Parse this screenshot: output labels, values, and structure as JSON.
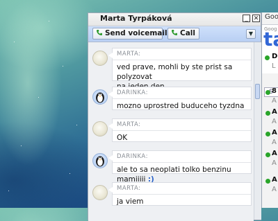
{
  "chat_window": {
    "title": "Marta Tyrpáková",
    "minimize_label": "_",
    "close_label": "✕",
    "toolbar": {
      "voicemail_label": "Send voicemail",
      "call_label": "Call",
      "more_label": "▼"
    },
    "messages": [
      {
        "sender": "MARTA:",
        "avatar": "marta",
        "lines": [
          "ved prave, mohli by ste prist sa polyzovat",
          "na jeden den"
        ]
      },
      {
        "sender": "DARINKA:",
        "avatar": "penguin",
        "lines": [
          "mozno uprostred buduceho tyzdna"
        ]
      },
      {
        "sender": "MARTA:",
        "avatar": "marta",
        "lines": [
          "OK"
        ]
      },
      {
        "sender": "DARINKA:",
        "avatar": "penguin",
        "lines": [
          "ale to sa neoplati tolko benzinu mamiiiii"
        ],
        "emoticon": ":)"
      },
      {
        "sender": "MARTA:",
        "avatar": "marta",
        "lines": [
          "ja viem"
        ]
      }
    ]
  },
  "gtalk_panel": {
    "title": "Goo",
    "logo_small": "Goog",
    "logo_text": "ta",
    "me_initial": "D",
    "me_status": "L",
    "search_glyph": "S",
    "contacts": [
      {
        "name": "8",
        "status": "A"
      },
      {
        "name": "A",
        "status": "A"
      },
      {
        "name": "A",
        "status": "A"
      },
      {
        "name": "A",
        "status": "A"
      },
      {
        "name": "A",
        "status": "A"
      }
    ]
  },
  "colors": {
    "toolbar_bg": "#c3d6f7",
    "online_green": "#2aa52a",
    "emoticon_blue": "#2a63c9",
    "logo_blue": "#3267d6",
    "logo_red": "#d23a2a"
  }
}
